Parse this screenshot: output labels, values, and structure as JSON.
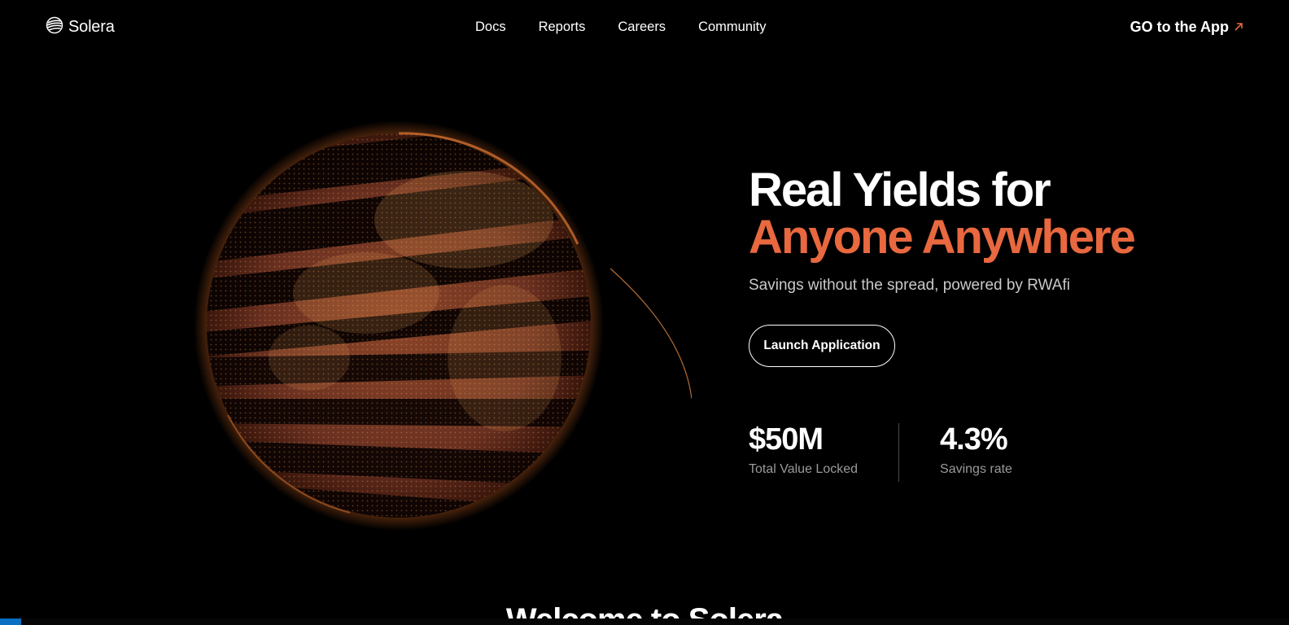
{
  "brand": {
    "name": "Solera",
    "logo_icon": "solera-logo-icon"
  },
  "nav": {
    "links": [
      "Docs",
      "Reports",
      "Careers",
      "Community"
    ]
  },
  "top_cta": {
    "label": "GO to the App",
    "icon": "arrow-up-right-icon"
  },
  "hero": {
    "title_line1": "Real Yields for",
    "title_line2": "Anyone Anywhere",
    "subtitle": "Savings without the spread, powered by RWAfi",
    "button_label": "Launch Application"
  },
  "stats": [
    {
      "value": "$50M",
      "label": "Total Value Locked"
    },
    {
      "value": "4.3%",
      "label": "Savings rate"
    }
  ],
  "next_section": {
    "title": "Welcome to Solera"
  },
  "colors": {
    "background": "#000000",
    "accent": "#e8683f",
    "globe": "#7a3a22"
  }
}
